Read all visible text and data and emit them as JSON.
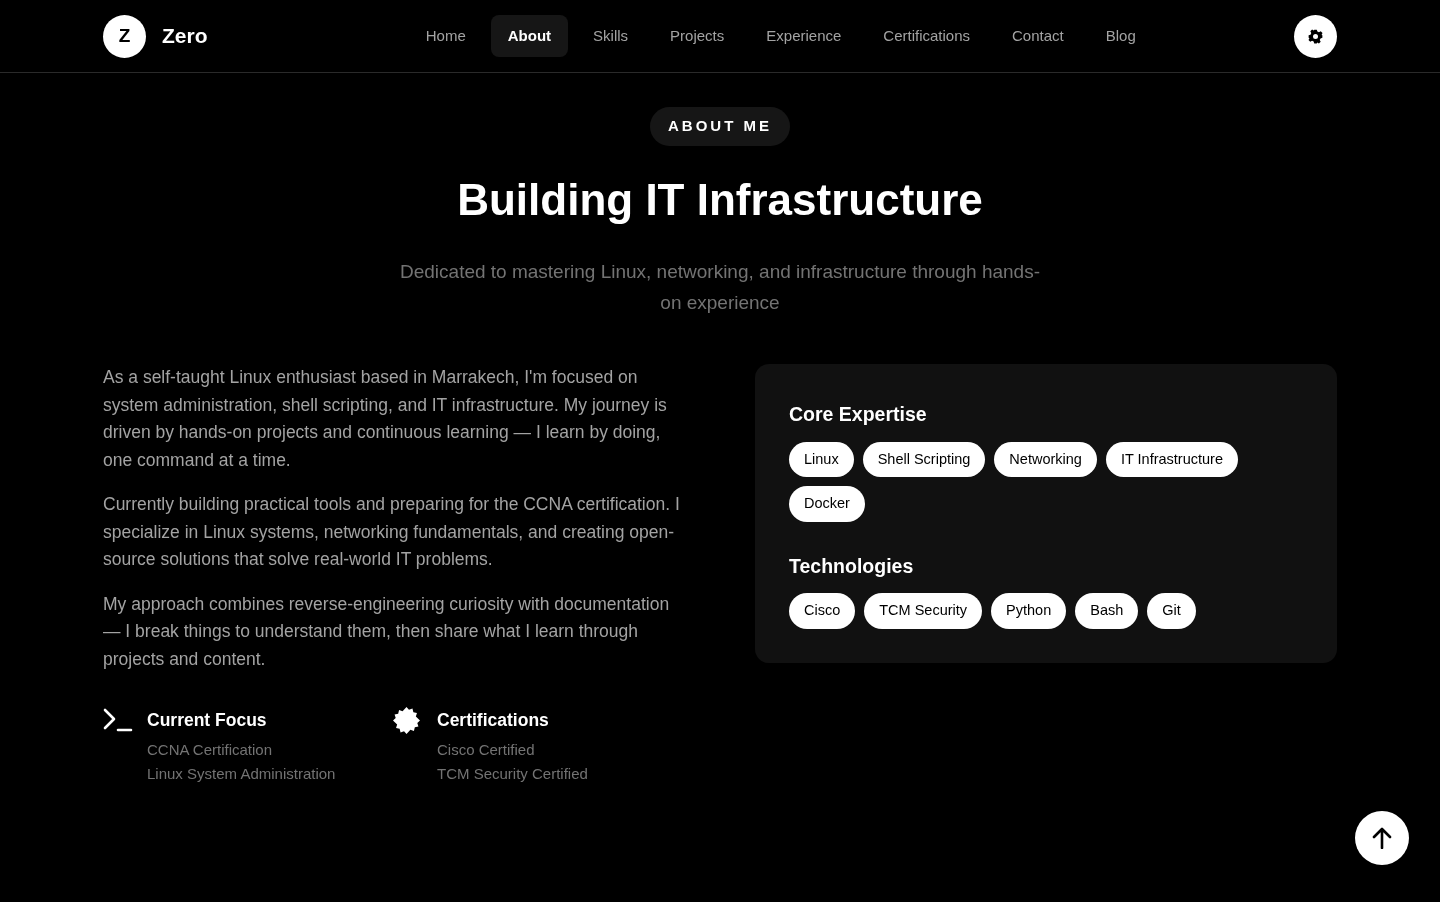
{
  "brand": {
    "initial": "Z",
    "name": "Zero"
  },
  "nav": [
    {
      "label": "Home",
      "selected": false
    },
    {
      "label": "About",
      "selected": true
    },
    {
      "label": "Skills",
      "selected": false
    },
    {
      "label": "Projects",
      "selected": false
    },
    {
      "label": "Experience",
      "selected": false
    },
    {
      "label": "Certifications",
      "selected": false
    },
    {
      "label": "Contact",
      "selected": false
    },
    {
      "label": "Blog",
      "selected": false
    }
  ],
  "header": {
    "badge": "ABOUT ME",
    "title": "Building IT Infrastructure",
    "subtitle": "Dedicated to mastering Linux, networking, and infrastructure through hands-on experience"
  },
  "paragraphs": [
    "As a self-taught Linux enthusiast based in Marrakech, I'm focused on system administration, shell scripting, and IT infrastructure. My journey is driven by hands-on projects and continuous learning — I learn by doing, one command at a time.",
    "Currently building practical tools and preparing for the CCNA certification. I specialize in Linux systems, networking fundamentals, and creating open-source solutions that solve real-world IT problems.",
    "My approach combines reverse-engineering curiosity with documentation — I break things to understand them, then share what I learn through projects and content."
  ],
  "highlights": [
    {
      "kind": "terminal",
      "title": "Current Focus",
      "lines": [
        "CCNA Certification",
        "Linux System Administration"
      ]
    },
    {
      "kind": "badge",
      "title": "Certifications",
      "lines": [
        "Cisco Certified",
        "TCM Security Certified"
      ]
    }
  ],
  "groups": [
    {
      "title": "Core Expertise",
      "tags": [
        "Linux",
        "Shell Scripting",
        "Networking",
        "IT Infrastructure",
        "Docker"
      ]
    },
    {
      "title": "Technologies",
      "tags": [
        "Cisco",
        "TCM Security",
        "Python",
        "Bash",
        "Git"
      ]
    }
  ]
}
